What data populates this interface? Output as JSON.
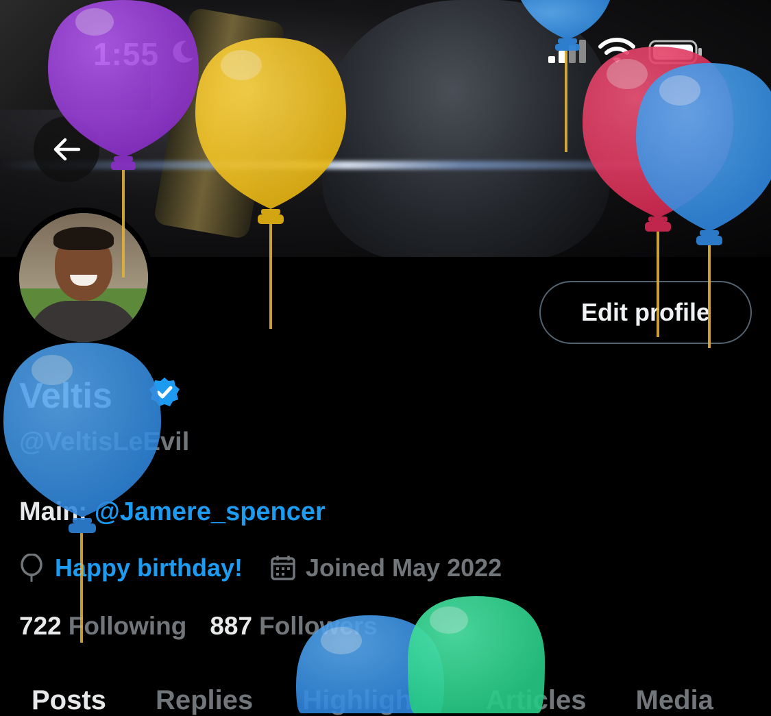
{
  "status": {
    "time": "1:55"
  },
  "profile": {
    "display_name": "Veltis",
    "handle": "@VeltisLeEvil",
    "bio_prefix": "Main: ",
    "bio_mention": "@Jamere_spencer",
    "birthday_text": "Happy birthday!",
    "joined_text": "Joined May 2022",
    "following_count": "722",
    "following_label": "Following",
    "followers_count": "887",
    "followers_label": "Followers"
  },
  "buttons": {
    "edit_profile": "Edit profile"
  },
  "tabs": [
    {
      "label": "Posts",
      "active": true
    },
    {
      "label": "Replies"
    },
    {
      "label": "Highlights"
    },
    {
      "label": "Articles"
    },
    {
      "label": "Media"
    }
  ],
  "colors": {
    "accent": "#1d9bf0",
    "balloon_purple": "#9b3fd6",
    "balloon_yellow": "#f2c21b",
    "balloon_red": "#e0345c",
    "balloon_blue": "#3a94e6",
    "balloon_green": "#2fd594"
  }
}
